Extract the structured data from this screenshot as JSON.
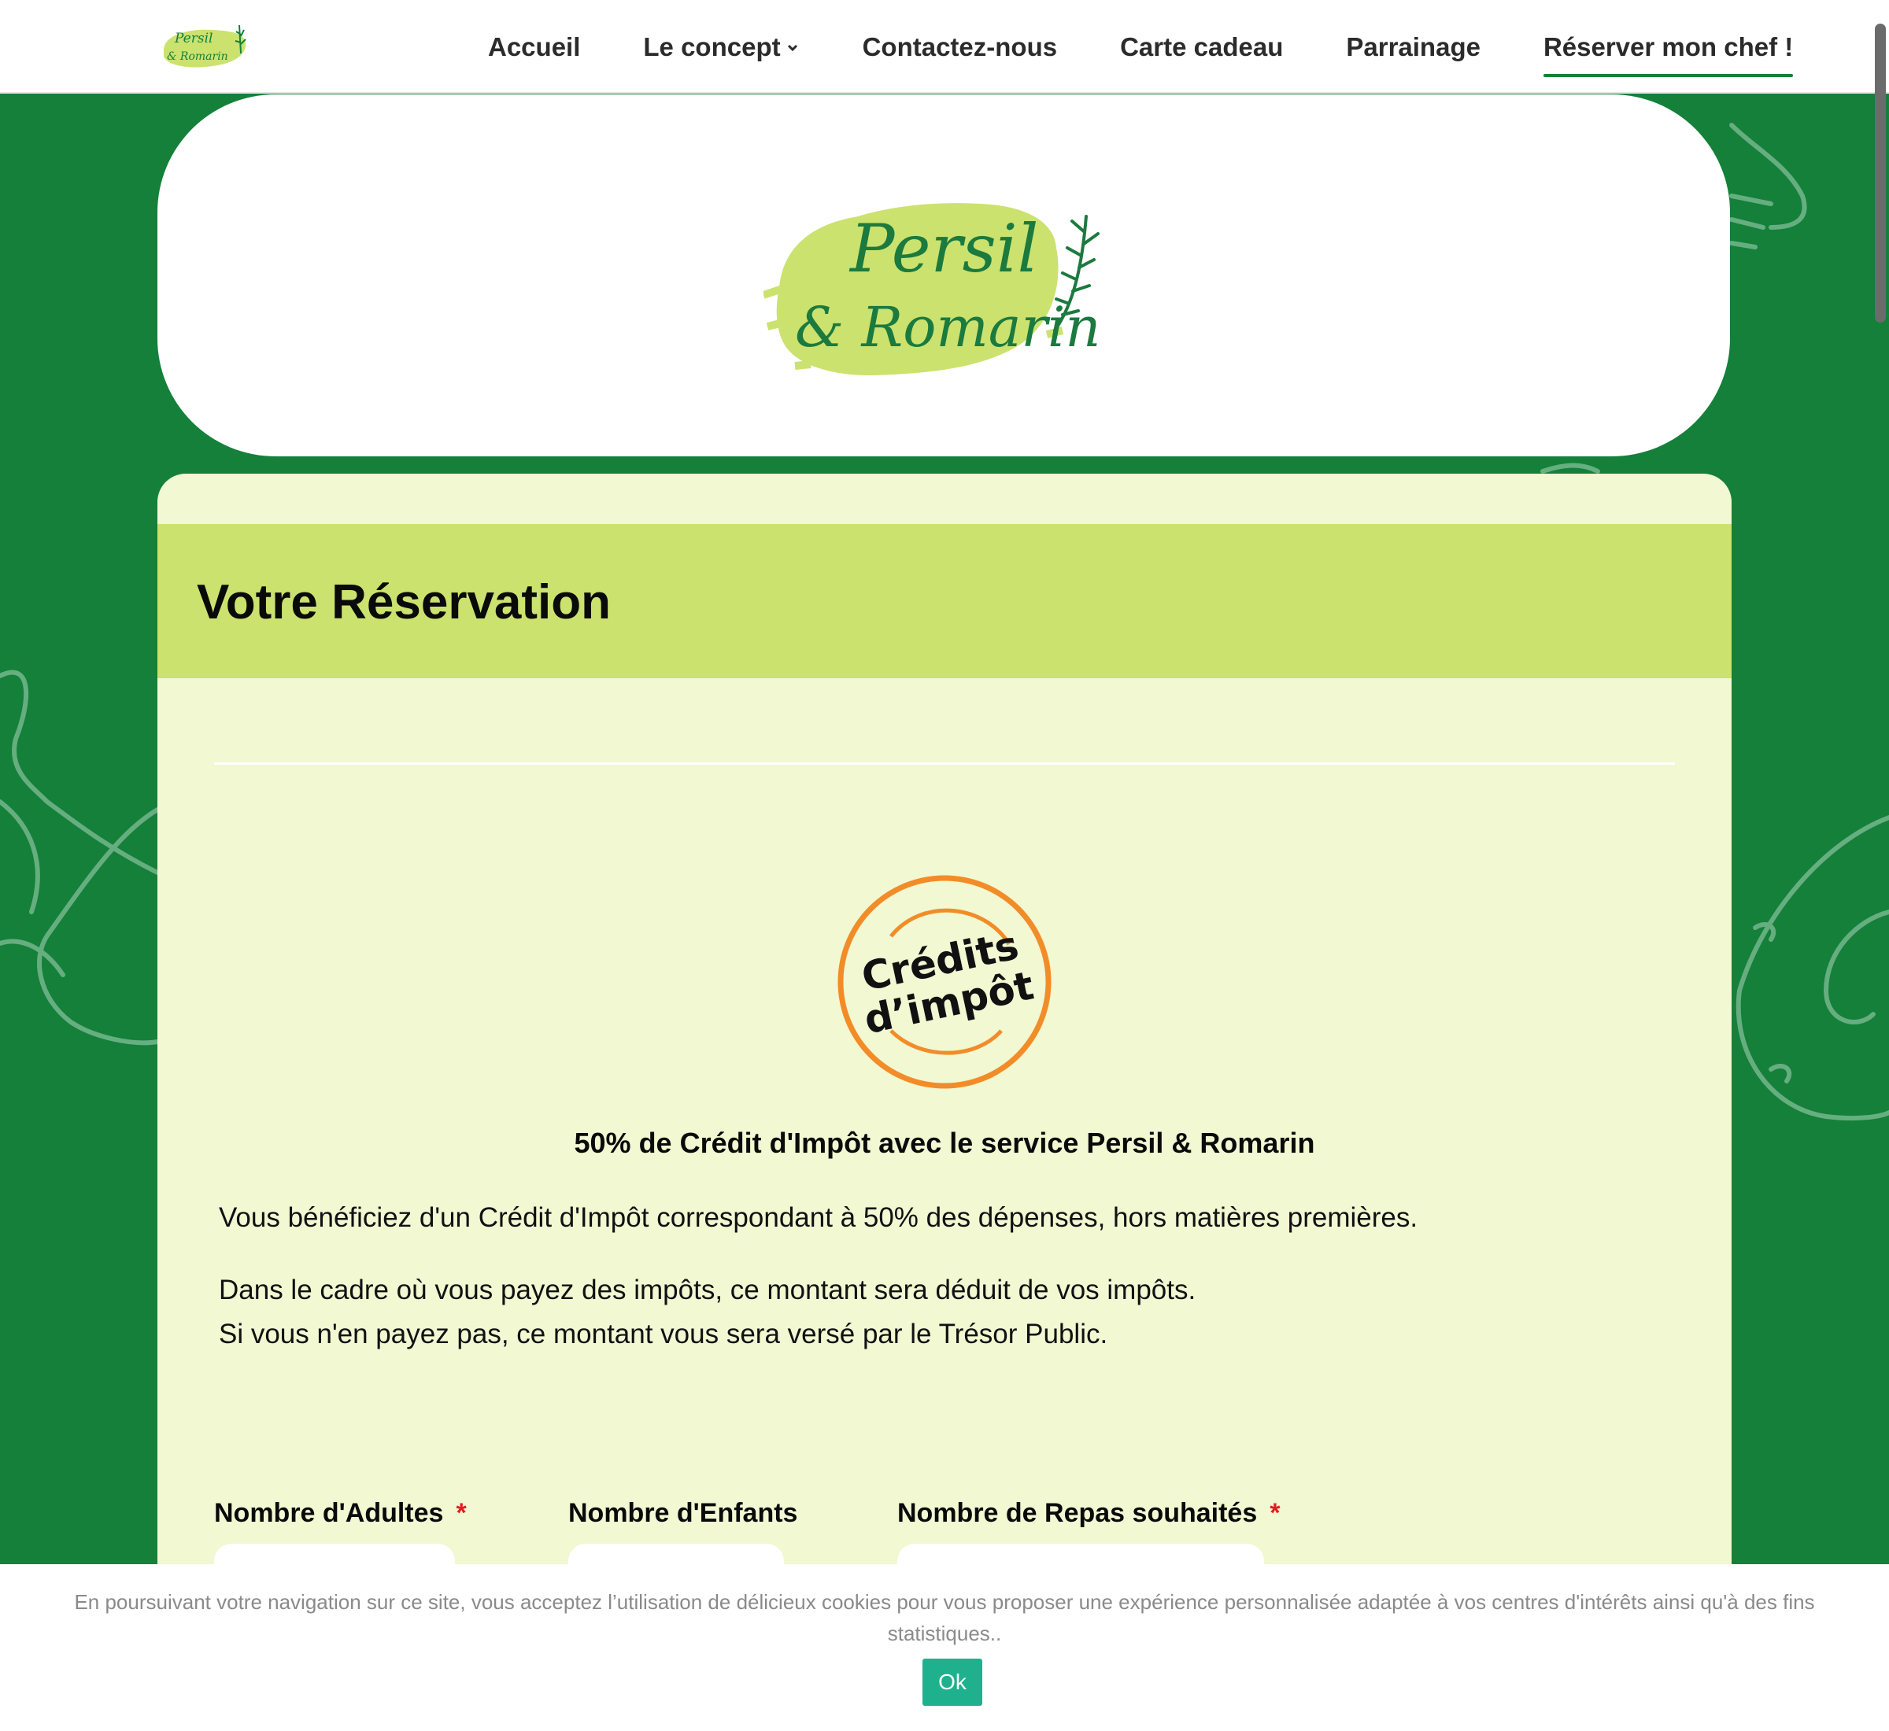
{
  "nav": {
    "items": [
      {
        "label": "Accueil",
        "active": false
      },
      {
        "label": "Le concept",
        "active": false,
        "has_dropdown": true
      },
      {
        "label": "Contactez-nous",
        "active": false
      },
      {
        "label": "Carte cadeau",
        "active": false
      },
      {
        "label": "Parrainage",
        "active": false
      },
      {
        "label": "Réserver mon chef !",
        "active": true
      }
    ]
  },
  "brand": {
    "logo_line1": "Persil",
    "logo_line2": "& Romarin",
    "icon": "rosemary-sprig-icon"
  },
  "reservation": {
    "title": "Votre Réservation",
    "badge_line1": "Crédits",
    "badge_line2": "d’impôt",
    "credit_heading": "50% de Crédit d'Impôt avec le service Persil & Romarin",
    "paragraph1": "Vous bénéficiez d'un Crédit d'Impôt correspondant à 50% des dépenses, hors matières premières.",
    "paragraph2_line1": "Dans le cadre où vous payez des impôts, ce montant sera déduit de vos impôts.",
    "paragraph2_line2": "Si vous n'en payez pas, ce montant vous sera versé par le Trésor Public.",
    "fields": {
      "adults_label": "Nombre d'Adultes",
      "children_label": "Nombre d'Enfants",
      "meals_label": "Nombre de Repas souhaités",
      "required_mark": "*"
    }
  },
  "cookie": {
    "text": "En poursuivant votre navigation sur ce site, vous acceptez l’utilisation de délicieux cookies pour vous proposer une expérience personnalisée adaptée à vos centres d'intérêts ainsi qu'à des fins statistiques..",
    "button": "Ok"
  },
  "colors": {
    "brand_green": "#148039",
    "lime": "#cbe26f",
    "card_bg": "#f1f8d2",
    "badge_orange": "#f28c28",
    "cookie_button": "#1fb18d"
  }
}
